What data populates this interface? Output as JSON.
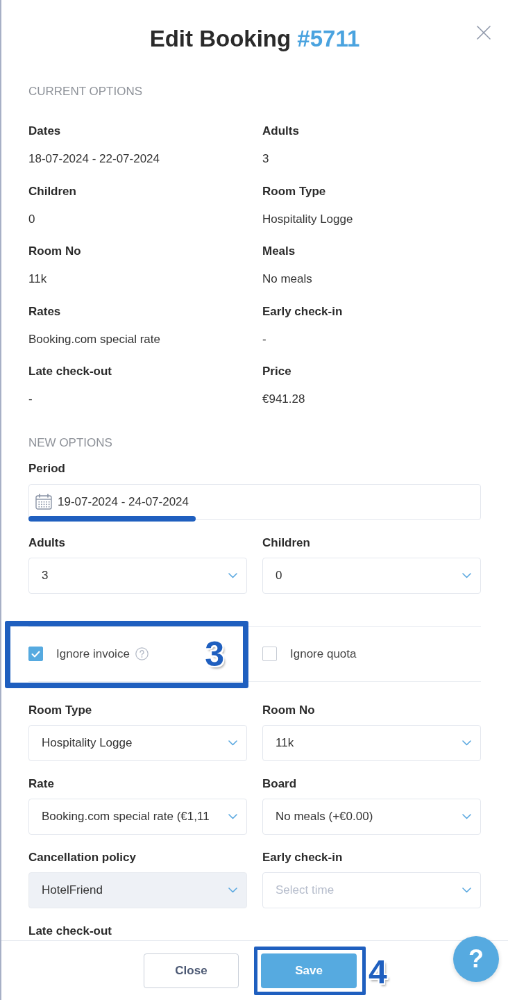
{
  "modal": {
    "title": "Edit Booking",
    "booking_number": "#5711"
  },
  "current_options": {
    "heading": "CURRENT OPTIONS",
    "fields": [
      {
        "label": "Dates",
        "value": "18-07-2024 - 22-07-2024"
      },
      {
        "label": "Adults",
        "value": "3"
      },
      {
        "label": "Children",
        "value": "0"
      },
      {
        "label": "Room Type",
        "value": "Hospitality Logge"
      },
      {
        "label": "Room No",
        "value": "11k"
      },
      {
        "label": "Meals",
        "value": "No meals"
      },
      {
        "label": "Rates",
        "value": "Booking.com special rate"
      },
      {
        "label": "Early check-in",
        "value": "-"
      },
      {
        "label": "Late check-out",
        "value": "-"
      },
      {
        "label": "Price",
        "value": "€941.28"
      }
    ]
  },
  "new_options": {
    "heading": "NEW OPTIONS",
    "period": {
      "label": "Period",
      "value": "19-07-2024 - 24-07-2024",
      "underlined": true
    },
    "guests": [
      {
        "label": "Adults",
        "value": "3",
        "disabled": false
      },
      {
        "label": "Children",
        "value": "0",
        "disabled": false
      }
    ],
    "flags": [
      {
        "label": "Ignore invoice",
        "checked": true,
        "help": true,
        "annotation": {
          "step": "3"
        }
      },
      {
        "label": "Ignore quota",
        "checked": false,
        "help": false
      }
    ],
    "booking_fields": [
      {
        "label": "Room Type",
        "value": "Hospitality Logge",
        "disabled": false
      },
      {
        "label": "Room No",
        "value": "11k",
        "disabled": false
      },
      {
        "label": "Rate",
        "value": "Booking.com special rate (€1,11",
        "disabled": false
      },
      {
        "label": "Board",
        "value": "No meals (+€0.00)",
        "disabled": false
      },
      {
        "label": "Cancellation policy",
        "value": "HotelFriend",
        "disabled": true
      },
      {
        "label": "Early check-in",
        "placeholder": "Select time",
        "disabled": false
      }
    ],
    "late_checkout": {
      "label": "Late check-out"
    }
  },
  "footer": {
    "buttons": [
      {
        "label": "Close",
        "kind": "secondary"
      },
      {
        "label": "Save",
        "kind": "primary",
        "annotation": {
          "step": "4"
        }
      }
    ],
    "help_button": {
      "label": "?"
    }
  }
}
